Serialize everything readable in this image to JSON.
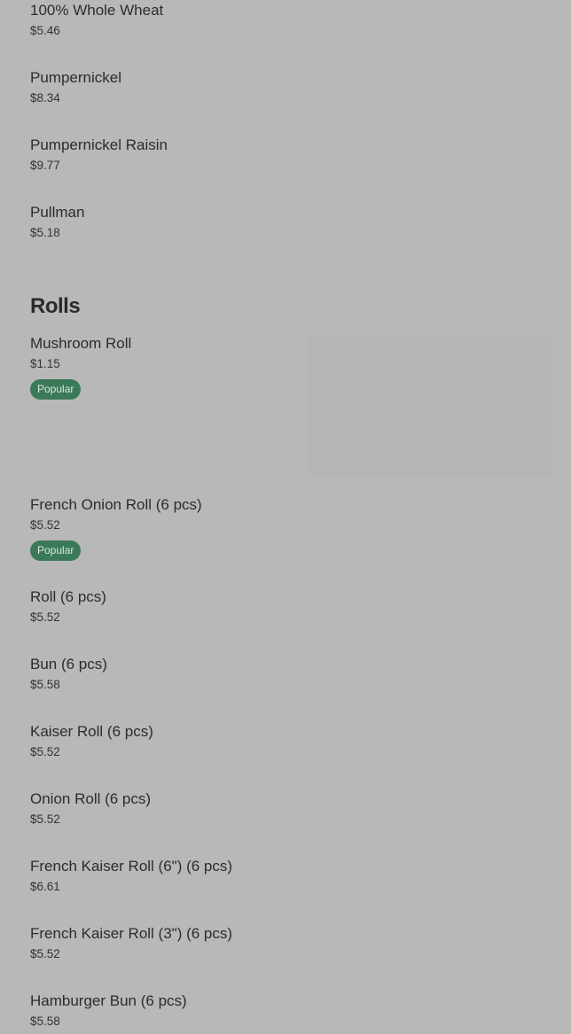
{
  "menu": {
    "items_top": [
      {
        "name": "100% Whole Wheat",
        "price": "$5.46"
      },
      {
        "name": "Pumpernickel",
        "price": "$8.34"
      },
      {
        "name": "Pumpernickel Raisin",
        "price": "$9.77"
      },
      {
        "name": "Pullman",
        "price": "$5.18"
      }
    ],
    "section": {
      "title": "Rolls"
    },
    "items_rolls": [
      {
        "name": "Mushroom Roll",
        "price": "$1.15",
        "badge": "Popular"
      },
      {
        "name": "French Onion Roll (6 pcs)",
        "price": "$5.52",
        "badge": "Popular"
      },
      {
        "name": "Roll (6 pcs)",
        "price": "$5.52"
      },
      {
        "name": "Bun (6 pcs)",
        "price": "$5.58"
      },
      {
        "name": "Kaiser Roll (6 pcs)",
        "price": "$5.52"
      },
      {
        "name": "Onion Roll (6 pcs)",
        "price": "$5.52"
      },
      {
        "name": "French Kaiser Roll (6\") (6 pcs)",
        "price": "$6.61"
      },
      {
        "name": "French Kaiser Roll (3\") (6 pcs)",
        "price": "$5.52"
      },
      {
        "name": "Hamburger Bun (6 pcs)",
        "price": "$5.58"
      }
    ]
  },
  "colors": {
    "background": "#b8b8b8",
    "badge_bg": "#3b7a58",
    "badge_text": "#d9e7de",
    "text": "#2c2c2c"
  }
}
